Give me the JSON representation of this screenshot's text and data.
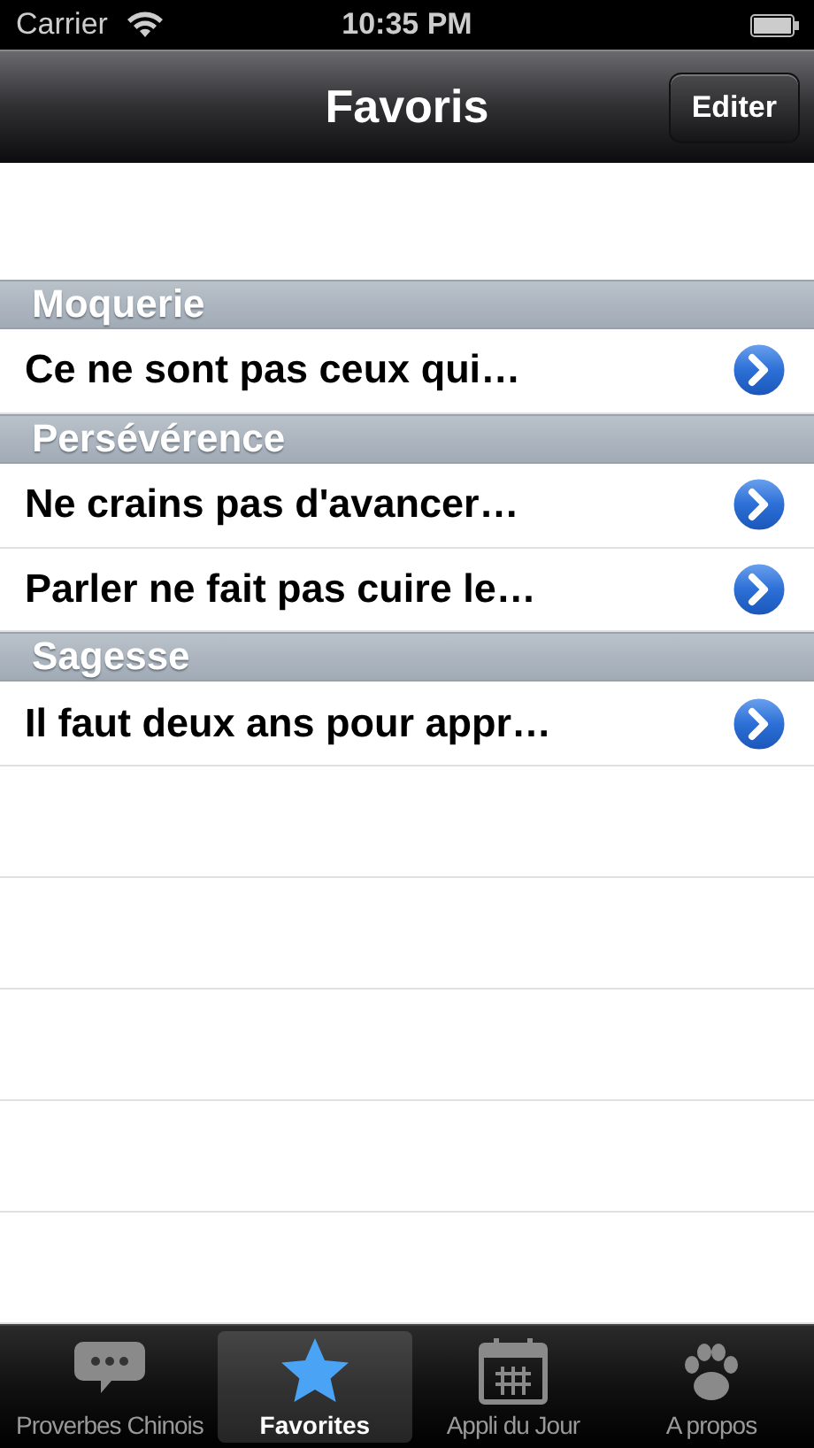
{
  "status_bar": {
    "carrier": "Carrier",
    "time": "10:35 PM"
  },
  "nav_bar": {
    "title": "Favoris",
    "edit_button": "Editer"
  },
  "sections": [
    {
      "header": "Moquerie",
      "rows": [
        "Ce ne sont pas ceux qui…"
      ]
    },
    {
      "header": "Persévérence",
      "rows": [
        "Ne crains pas d'avancer…",
        "Parler ne fait pas cuire le…"
      ]
    },
    {
      "header": "Sagesse",
      "rows": [
        "Il faut deux ans pour appr…"
      ]
    }
  ],
  "tab_bar": [
    {
      "label": "Proverbes Chinois",
      "kind": "bubble",
      "selected": false
    },
    {
      "label": "Favorites",
      "kind": "star",
      "selected": true
    },
    {
      "label": "Appli du Jour",
      "kind": "calendar",
      "selected": false
    },
    {
      "label": "A propos",
      "kind": "paw",
      "selected": false
    }
  ]
}
